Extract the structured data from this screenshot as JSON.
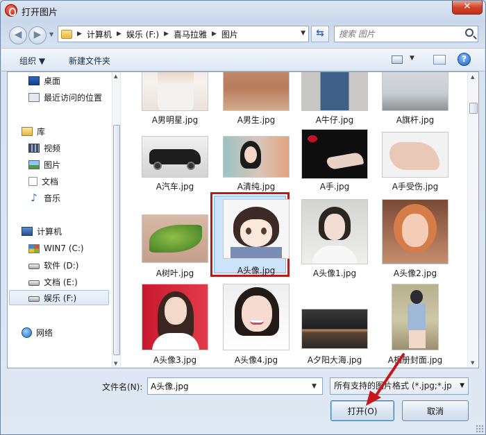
{
  "window": {
    "title": "打开图片",
    "close": "✕"
  },
  "address": {
    "crumbs": [
      "计算机",
      "娱乐 (F:)",
      "喜马拉雅",
      "图片"
    ],
    "search_placeholder": "搜索 图片"
  },
  "toolbar": {
    "organize": "组织 ▼",
    "new_folder": "新建文件夹",
    "help": "?"
  },
  "nav": {
    "items": [
      {
        "label": "桌面",
        "icon": "desktop-icon"
      },
      {
        "label": "最近访问的位置",
        "icon": "recent-places-icon"
      },
      {
        "label": "库",
        "icon": "library-icon"
      },
      {
        "label": "视频",
        "icon": "video-icon"
      },
      {
        "label": "图片",
        "icon": "pictures-icon"
      },
      {
        "label": "文档",
        "icon": "documents-icon"
      },
      {
        "label": "音乐",
        "icon": "music-icon"
      },
      {
        "label": "计算机",
        "icon": "computer-icon"
      },
      {
        "label": "WIN7 (C:)",
        "icon": "windows-drive-icon"
      },
      {
        "label": "软件 (D:)",
        "icon": "drive-icon"
      },
      {
        "label": "文档 (E:)",
        "icon": "drive-icon"
      },
      {
        "label": "娱乐 (F:)",
        "icon": "drive-icon",
        "selected": true
      },
      {
        "label": "网络",
        "icon": "network-icon"
      }
    ]
  },
  "files": [
    {
      "name": "A男明星.jpg"
    },
    {
      "name": "A男生.jpg"
    },
    {
      "name": "A牛仔.jpg"
    },
    {
      "name": "A旗杆.jpg"
    },
    {
      "name": "A汽车.jpg"
    },
    {
      "name": "A清纯.jpg"
    },
    {
      "name": "A手.jpg"
    },
    {
      "name": "A手受伤.jpg"
    },
    {
      "name": "A树叶.jpg"
    },
    {
      "name": "A头像.jpg",
      "selected": true
    },
    {
      "name": "A头像1.jpg"
    },
    {
      "name": "A头像2.jpg"
    },
    {
      "name": "A头像3.jpg"
    },
    {
      "name": "A头像4.jpg"
    },
    {
      "name": "A夕阳大海.jpg"
    },
    {
      "name": "A相册封面.jpg"
    }
  ],
  "bottom": {
    "filename_label": "文件名(N):",
    "filename_value": "A头像.jpg",
    "filter_value": "所有支持的图片格式 (*.jpg;*.jp",
    "open_button": "打开(O)",
    "cancel_button": "取消"
  },
  "colors": {
    "selection_box": "#b11d1d",
    "annotation_arrow": "#c8161d"
  }
}
